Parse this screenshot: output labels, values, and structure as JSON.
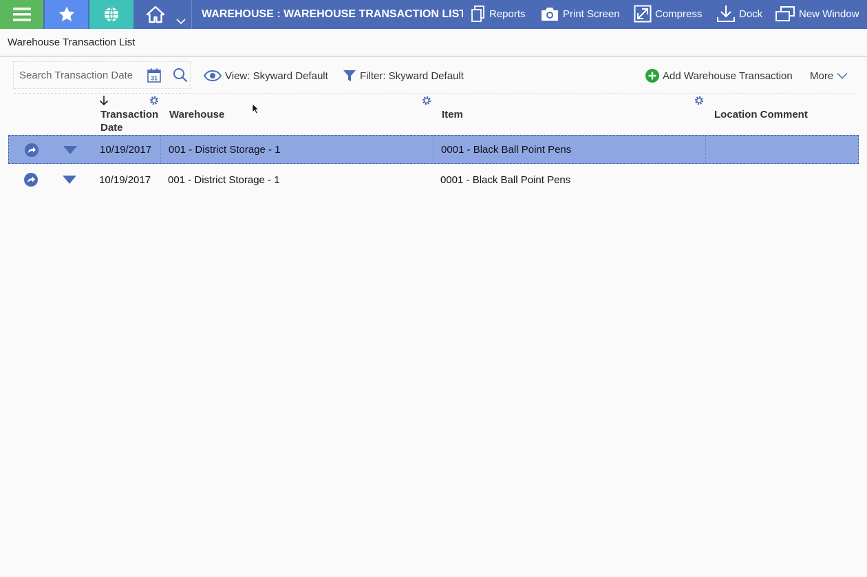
{
  "topbar": {
    "title": "WAREHOUSE : WAREHOUSE TRANSACTION LIST",
    "icons": [
      "menu-icon",
      "star-icon",
      "globe-icon",
      "home-icon",
      "chevron-down-icon"
    ],
    "actions": [
      {
        "label": "Reports",
        "icon": "reports-icon"
      },
      {
        "label": "Print Screen",
        "icon": "camera-icon"
      },
      {
        "label": "Compress",
        "icon": "compress-icon"
      },
      {
        "label": "Dock",
        "icon": "dock-icon"
      },
      {
        "label": "New Window",
        "icon": "new-window-icon"
      }
    ],
    "colors": {
      "bar": "#4b6bb7",
      "menu": "#5cb85c",
      "favorites": "#5b8def",
      "globe": "#3fc3b8"
    }
  },
  "page": {
    "title": "Warehouse Transaction List"
  },
  "toolbar": {
    "search_placeholder": "Search Transaction Date",
    "calendar_day": "31",
    "view_label": "View: Skyward Default",
    "filter_label": "Filter: Skyward Default",
    "add_label": "Add Warehouse Transaction",
    "more_label": "More",
    "accent": "#2aa535"
  },
  "grid": {
    "columns": [
      {
        "line1": "Transaction",
        "line2": "Date",
        "sorted": "descending"
      },
      {
        "line1": "Warehouse"
      },
      {
        "line1": "Item"
      },
      {
        "line1": "Location Comment"
      }
    ],
    "rows": [
      {
        "date": "10/19/2017",
        "warehouse": "001 - District Storage - 1",
        "item": "0001 - Black Ball Point Pens",
        "location_comment": "",
        "selected": true
      },
      {
        "date": "10/19/2017",
        "warehouse": "001 - District Storage - 1",
        "item": "0001 - Black Ball Point Pens",
        "location_comment": "",
        "selected": false
      }
    ],
    "selected_color": "#8ea6e2"
  }
}
